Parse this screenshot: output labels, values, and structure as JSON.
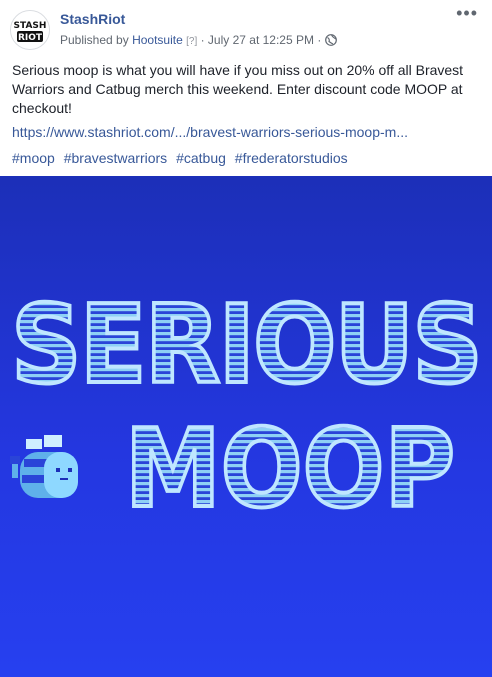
{
  "post": {
    "page_name": "StashRiot",
    "published_by_prefix": "Published by",
    "publisher": "Hootsuite",
    "help_marker": "[?]",
    "separator": "·",
    "timestamp": "July 27 at 12:25 PM",
    "privacy_icon": "globe-icon",
    "more_icon": "more-options-icon",
    "more_label": "•••",
    "avatar": {
      "line1": "STASH",
      "line2": "RIOT"
    },
    "message": "Serious moop is what you will have if you miss out on 20% off all Bravest Warriors and Catbug merch this weekend. Enter discount code MOOP at checkout!",
    "link": "https://www.stashriot.com/.../bravest-warriors-serious-moop-m...",
    "hashtags": [
      "#moop",
      "#bravestwarriors",
      "#catbug",
      "#frederatorstudios"
    ]
  },
  "image": {
    "line1": "SERIOUS",
    "line2": "MOOP",
    "character_icon": "catbug-icon"
  },
  "colors": {
    "link": "#385898",
    "meta": "#606770",
    "background_top": "#1c2fb8",
    "background_bottom": "#2640f0",
    "letter_fill": "#8ed0f5",
    "letter_stroke": "#bfe6ff"
  }
}
